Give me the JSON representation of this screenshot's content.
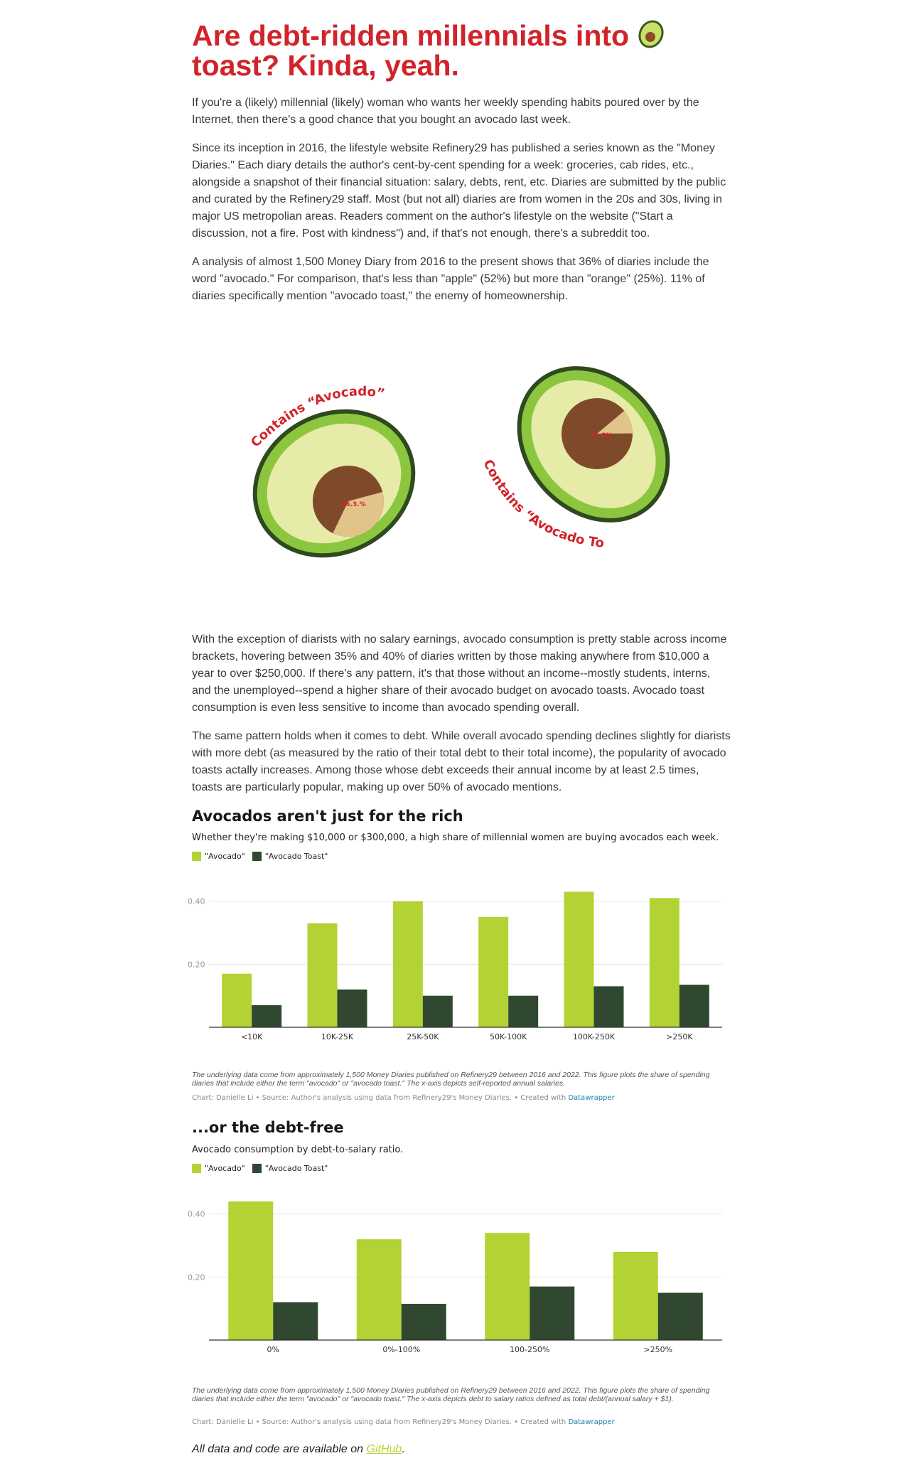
{
  "article": {
    "title": "Are debt-ridden millennials into",
    "title_line2": "toast? Kinda, yeah.",
    "paragraphs": [
      "If you're a (likely) millennial (likely) woman who wants her weekly spending habits poured over by the Internet, then there's a good chance that you bought an avocado last week.",
      "Since its inception in 2016, the lifestyle website Refinery29 has published a series known as the \"Money Diaries.\" Each diary details the author's cent-by-cent spending for a week: groceries, cab rides, etc., alongside a snapshot of their financial situation: salary, debts, rent, etc. Diaries are submitted by the public and curated by the Refinery29 staff. Most (but not all) diaries are from women in the 20s and 30s, living in major US metropolian areas. Readers comment on the author's lifestyle on the website (\"Start a discussion, not a fire. Post with kindness\") and, if that's not enough, there's a subreddit too.",
      "A analysis of almost 1,500 Money Diary from 2016 to the present shows that 36% of diaries include the word \"avocado.\" For comparison, that's less than \"apple\" (52%) but more than \"orange\" (25%). 11% of diaries specifically mention \"avocado toast,\" the enemy of homeownership.",
      "With the exception of diarists with no salary earnings, avocado consumption is pretty stable across income brackets, hovering between 35% and 40% of diaries written by those making anywhere from $10,000 a year to over $250,000. If there's any pattern, it's that those without an income--mostly students, interns, and the unemployed--spend a higher share of their avocado budget on avocado toasts. Avocado toast consumption is even less sensitive to income than avocado spending overall.",
      "The same pattern holds when it comes to debt. While overall avocado spending declines slightly for diarists with more debt (as measured by the ratio of their total debt to their total income), the popularity of avocado toasts actally increases. Among those whose debt exceeds their annual income by at least 2.5 times, toasts are particularly popular, making up over 50% of avocado mentions."
    ],
    "footer_prefix": "All data and code are available on ",
    "footer_link": "GitHub",
    "footer_suffix": "."
  },
  "illustration": {
    "left_label": "Contains “Avocado”",
    "left_pct_label": "36.3.%",
    "left_pct": 36.3,
    "right_label": "Contains “Avocado Toast”",
    "right_pct_label": "11.0%",
    "right_pct": 11.0,
    "colors": {
      "skin": "#2e4a1e",
      "rind": "#8cc63f",
      "flesh": "#e6eba8",
      "pit": "#7f4a2a",
      "slice": "#e2c48a",
      "label": "#d2232a"
    }
  },
  "legend": {
    "avocado": "\"Avocado\"",
    "toast": "\"Avocado Toast\""
  },
  "colors": {
    "avocado": "#b3d334",
    "toast": "#304830",
    "grid": "#e6e6e6",
    "axis": "#333333"
  },
  "chart_data": [
    {
      "type": "bar",
      "title": "Avocados aren't just for the rich",
      "subtitle": "Whether they're making $10,000 or $300,000, a high share of millennial women are buying avocados each week.",
      "categories": [
        "<10K",
        "10K-25K",
        "25K-50K",
        "50K-100K",
        "100K-250K",
        ">250K"
      ],
      "series": [
        {
          "name": "\"Avocado\"",
          "values": [
            0.17,
            0.33,
            0.4,
            0.35,
            0.43,
            0.41
          ]
        },
        {
          "name": "\"Avocado Toast\"",
          "values": [
            0.07,
            0.12,
            0.1,
            0.1,
            0.13,
            0.135
          ]
        }
      ],
      "yticks": [
        0.2,
        0.4
      ],
      "ytick_labels": [
        "0.20",
        "0.40"
      ],
      "ylim": [
        0,
        0.44
      ],
      "grid": true,
      "legend": "top-left",
      "note": "The underlying data come from approximately 1,500 Money Diaries published on Refinery29 between 2016 and 2022. This figure plots the share of spending diaries that include either the term \"avocado\" or \"avocado toast.\" The x-axis depicts self-reported annual salaries.",
      "credit": "Chart: Danielle Li • Source: Author's analysis using data from Refinery29's Money Diaries. • Created with ",
      "credit_link": "Datawrapper"
    },
    {
      "type": "bar",
      "title": "...or the debt-free",
      "subtitle": "Avocado consumption by debt-to-salary ratio.",
      "categories": [
        "0%",
        "0%-100%",
        "100-250%",
        ">250%"
      ],
      "series": [
        {
          "name": "\"Avocado\"",
          "values": [
            0.44,
            0.32,
            0.34,
            0.28
          ]
        },
        {
          "name": "\"Avocado Toast\"",
          "values": [
            0.12,
            0.115,
            0.17,
            0.15
          ]
        }
      ],
      "yticks": [
        0.2,
        0.4
      ],
      "ytick_labels": [
        "0.20",
        "0.40"
      ],
      "ylim": [
        0,
        0.44
      ],
      "grid": true,
      "legend": "top-left",
      "note": "The underlying data come from approximately 1,500 Money Diaries published on Refinery29 between 2016 and 2022. This figure plots the share of spending diaries that include either the term \"avocado\" or \"avocado toast.\" The x-axis depicts debt to salary ratios defined as total debt/(annual salary + $1).",
      "credit": "Chart: Danielle Li • Source: Author's analysis using data from Refinery29's Money Diaries. • Created with ",
      "credit_link": "Datawrapper"
    }
  ]
}
